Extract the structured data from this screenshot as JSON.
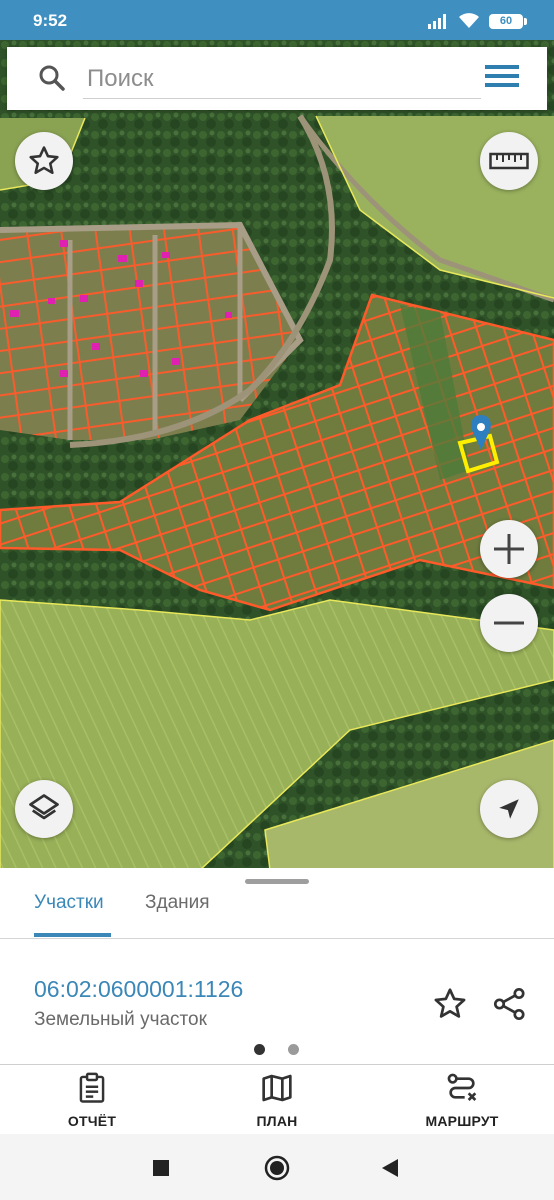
{
  "status_bar": {
    "time": "9:52",
    "battery": "60"
  },
  "search": {
    "placeholder": "Поиск"
  },
  "icons": {
    "search": "search-icon",
    "menu": "hamburger-menu-icon",
    "favorite": "star-icon",
    "ruler": "ruler-icon",
    "zoom_in": "plus-icon",
    "zoom_out": "minus-icon",
    "layers": "layers-icon",
    "locate": "navigation-arrow-icon",
    "share": "share-icon",
    "report": "clipboard-icon",
    "plan": "map-icon",
    "route": "route-icon"
  },
  "colors": {
    "accent": "#3a87b8",
    "status_bar": "#3f8fc0",
    "parcel_outline": "#ff5a2a",
    "selected_parcel": "#ffee00",
    "boundary": "#e8e85a"
  },
  "tabs": [
    {
      "label": "Участки",
      "active": true
    },
    {
      "label": "Здания",
      "active": false
    }
  ],
  "parcel": {
    "cadastral_number": "06:02:0600001:1126",
    "type": "Земельный участок"
  },
  "pager": {
    "pages": 2,
    "current": 1
  },
  "actions": [
    {
      "label": "ОТЧЁТ"
    },
    {
      "label": "ПЛАН"
    },
    {
      "label": "МАРШРУТ"
    }
  ]
}
